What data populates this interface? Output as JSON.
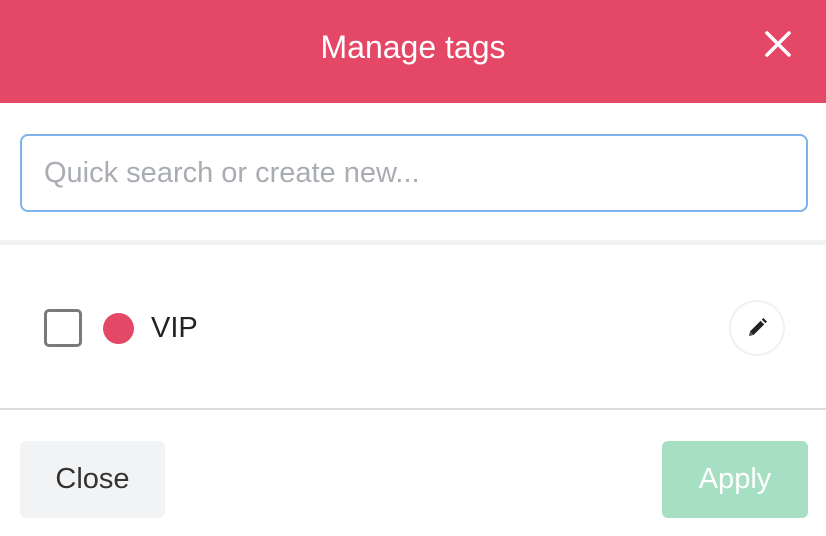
{
  "modal": {
    "title": "Manage tags",
    "close_icon": "close-icon"
  },
  "search": {
    "placeholder": "Quick search or create new...",
    "value": ""
  },
  "tags": [
    {
      "label": "VIP",
      "color": "#e54767",
      "checked": false,
      "edit_icon": "pencil-icon"
    }
  ],
  "footer": {
    "close_label": "Close",
    "apply_label": "Apply",
    "apply_enabled": false
  },
  "colors": {
    "header": "#e54767",
    "apply_disabled": "#a7dfc3",
    "search_border": "#7fb2ec"
  }
}
